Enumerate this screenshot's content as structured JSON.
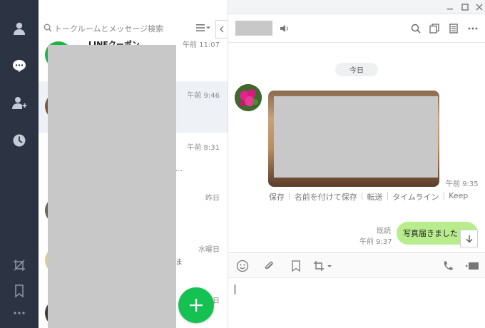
{
  "search": {
    "placeholder": "トークルームとメッセージ検索"
  },
  "chat_list": {
    "items": [
      {
        "time": "午前 11:07",
        "name": "LINEクーポン",
        "snippet": ""
      },
      {
        "time": "午前 9:46",
        "name": "",
        "snippet": ""
      },
      {
        "time": "午前 8:31",
        "name": "",
        "snippet": "…"
      },
      {
        "time": "昨日",
        "name": "",
        "snippet": ""
      },
      {
        "time": "水曜日",
        "name": "",
        "snippet": "ま"
      },
      {
        "time": "日",
        "name": "",
        "snippet": ""
      }
    ]
  },
  "chat": {
    "date_separator": "今日",
    "photo_time": "午前 9:35",
    "photo_actions": [
      "保存",
      "名前を付けて保存",
      "転送",
      "タイムライン",
      "Keep"
    ],
    "read_status": "既読",
    "message_time": "午前 9:37",
    "message_text": "写真届きました"
  },
  "colors": {
    "sidebar_bg": "#2c3444",
    "accent_green": "#15c152",
    "bubble_green": "#b9ec8d"
  }
}
